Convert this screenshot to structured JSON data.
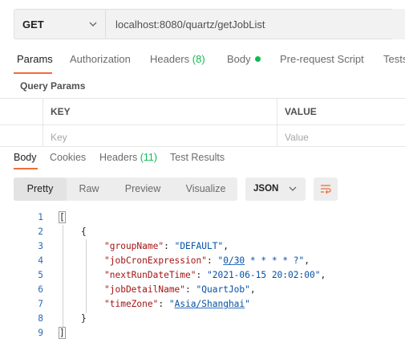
{
  "request": {
    "method": "GET",
    "url": "localhost:8080/quartz/getJobList"
  },
  "request_tabs": [
    {
      "label": "Params",
      "count": ""
    },
    {
      "label": "Authorization",
      "count": ""
    },
    {
      "label": "Headers",
      "count": "(8)"
    },
    {
      "label": "Body",
      "count": ""
    },
    {
      "label": "Pre-request Script",
      "count": ""
    },
    {
      "label": "Tests",
      "count": ""
    }
  ],
  "query_params": {
    "title": "Query Params",
    "columns": [
      "KEY",
      "VALUE"
    ],
    "placeholders": [
      "Key",
      "Value"
    ]
  },
  "response_tabs": [
    {
      "label": "Body",
      "count": ""
    },
    {
      "label": "Cookies",
      "count": ""
    },
    {
      "label": "Headers",
      "count": "(11)"
    },
    {
      "label": "Test Results",
      "count": ""
    }
  ],
  "view_modes": [
    "Pretty",
    "Raw",
    "Preview",
    "Visualize"
  ],
  "format": "JSON",
  "colors": {
    "accent": "#f26b3a",
    "count_green": "#0cbb52",
    "json_key": "#a31515",
    "json_string": "#0451a5",
    "line_number": "#2a6ab8"
  },
  "response_body": {
    "line_numbers": [
      "1",
      "2",
      "3",
      "4",
      "5",
      "6",
      "7",
      "8",
      "9"
    ],
    "open_array": "[",
    "open_object": "{",
    "close_object": "}",
    "close_array": "]",
    "fields": [
      {
        "key": "\"groupName\"",
        "value": "\"DEFAULT\"",
        "comma": ","
      },
      {
        "key": "\"jobCronExpression\"",
        "value": "\"0/30 * * * * ?\"",
        "comma": ","
      },
      {
        "key": "\"nextRunDateTime\"",
        "value": "\"2021-06-15 20:02:00\"",
        "comma": ","
      },
      {
        "key": "\"jobDetailName\"",
        "value": "\"QuartJob\"",
        "comma": ","
      },
      {
        "key": "\"timeZone\"",
        "value": "\"Asia/Shanghai\"",
        "comma": ""
      }
    ]
  }
}
